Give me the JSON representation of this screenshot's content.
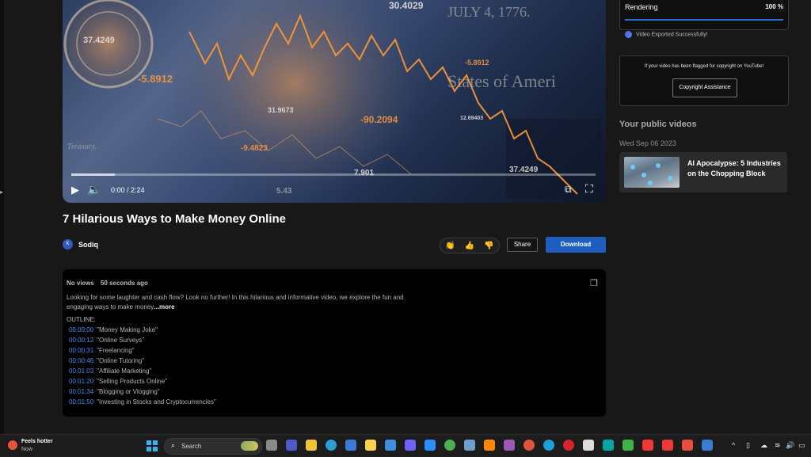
{
  "video": {
    "time": "0:00 / 2:24",
    "overlay_numbers": [
      "37.4249",
      "-5.8912",
      "30.4029",
      "-5.8912",
      "31.9673",
      "-90.2094",
      "12.69403",
      "-9.4823",
      "7.901",
      "37.4249",
      "5.43"
    ],
    "overlay_text": [
      "JULY 4, 1776.",
      "States of Ameri",
      "Treasury."
    ]
  },
  "title": "7 Hilarious Ways to Make Money Online",
  "channel": {
    "avatar_letter": "K",
    "name": "Sodiq"
  },
  "actions": {
    "share": "Share",
    "download": "Download"
  },
  "description": {
    "views": "No views",
    "age": "50 seconds ago",
    "summary": "Looking for some laughter and cash flow? Look no further! In this hilarious and informative video, we explore the fun and engaging ways to make money",
    "more": "...more",
    "outline_label": "OUTLINE:",
    "outline": [
      {
        "ts": "00:00:00",
        "label": "\"Money Making Joke\""
      },
      {
        "ts": "00:00:12",
        "label": "\"Online Surveys\""
      },
      {
        "ts": "00:00:31",
        "label": "\"Freelancing\""
      },
      {
        "ts": "00:00:46",
        "label": "\"Online Tutoring\""
      },
      {
        "ts": "00:01:03",
        "label": "\"Affiliate Marketing\""
      },
      {
        "ts": "00:01:20",
        "label": "\"Selling Products Online\""
      },
      {
        "ts": "00:01:34",
        "label": "\"Blogging or Vlogging\""
      },
      {
        "ts": "00:01:50",
        "label": "\"Investing in Stocks and Cryptocurrencies\""
      }
    ]
  },
  "render": {
    "label": "Rendering",
    "percent": "100 %",
    "progress": 1.0,
    "status": "Video Exported Successfully!"
  },
  "copyright": {
    "text": "If your video has been flagged for copyright on YouTube!",
    "button": "Copyright Assistance"
  },
  "public_videos": {
    "heading": "Your public videos",
    "date": "Wed Sep 06 2023",
    "items": [
      {
        "title": "AI Apocalypse: 5 Industries on the Chopping Block"
      }
    ]
  },
  "taskbar": {
    "weather_title": "Feels hotter",
    "weather_sub": "Now",
    "search_placeholder": "Search"
  },
  "colors": {
    "accent": "#1c5dbd",
    "link": "#3e8cf2",
    "background": "#181818"
  }
}
